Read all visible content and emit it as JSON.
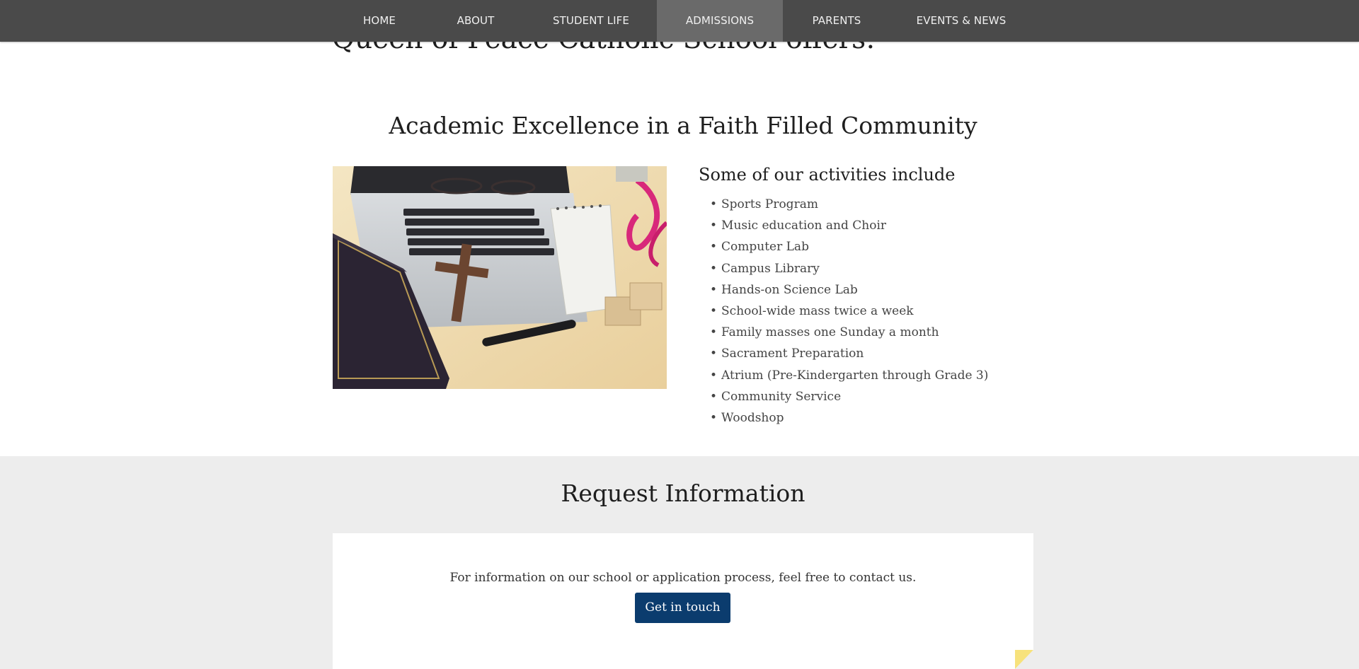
{
  "nav": {
    "items": [
      {
        "label": "HOME"
      },
      {
        "label": "ABOUT"
      },
      {
        "label": "STUDENT LIFE"
      },
      {
        "label": "ADMISSIONS"
      },
      {
        "label": "PARENTS"
      },
      {
        "label": "EVENTS & NEWS"
      }
    ],
    "active": "ADMISSIONS"
  },
  "intro": {
    "partial_heading": "Queen of Peace Catholic School offers:"
  },
  "academics": {
    "title": "Academic Excellence in a Faith Filled Community",
    "activities_title": "Some of our activities include",
    "activities": [
      "Sports Program",
      "Music education and Choir",
      "Computer Lab",
      "Campus Library",
      "Hands-on Science Lab",
      "School-wide mass twice a week",
      "Family masses one Sunday a month",
      "Sacrament Preparation",
      "Atrium (Pre-Kindergarten through Grade 3)",
      "Community Service",
      "Woodshop"
    ]
  },
  "request": {
    "title": "Request Information",
    "text": "For information on our school or application process, feel free to contact us.",
    "button_label": "Get in touch"
  },
  "colors": {
    "nav_bg": "#4a4a4a",
    "nav_active": "#6a6a6a",
    "button_bg": "#0b3c6e",
    "request_bg": "#ededed",
    "corner_flag": "#f7e27c"
  }
}
